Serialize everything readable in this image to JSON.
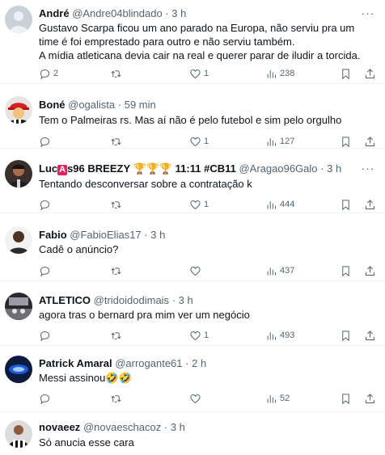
{
  "tweets": [
    {
      "name": "André",
      "handle": "@Andre04blindado",
      "time": "3 h",
      "text": "Gustavo Scarpa ficou um ano parado na Europa, não serviu pra um time é foi emprestado para outro e não serviu também.\nA mídia atleticana devia cair na real e querer parar de iludir a torcida.",
      "replies": "2",
      "retweets": "",
      "likes": "1",
      "views": "238"
    },
    {
      "name": "Boné",
      "handle": "@ogalista",
      "time": "59 min",
      "text": "Tem o Palmeiras rs. Mas aí não é pelo futebol e sim pelo orgulho",
      "replies": "",
      "retweets": "",
      "likes": "1",
      "views": "127"
    },
    {
      "name_pre": "Luc",
      "name_badge": "A",
      "name_post": "s96 BREEZY 🏆🏆🏆 11:11 #CB11",
      "handle": "@Aragao96Galo",
      "time": "3 h",
      "text": "Tentando desconversar sobre a contratação k",
      "replies": "",
      "retweets": "",
      "likes": "1",
      "views": "444"
    },
    {
      "name": "Fabio",
      "handle": "@FabioElias17",
      "time": "3 h",
      "text": "Cadê o anúncio?",
      "replies": "",
      "retweets": "",
      "likes": "",
      "views": "437"
    },
    {
      "name": "ATLETICO",
      "handle": "@tridoidodimais",
      "time": "3 h",
      "text": "agora tras o bernard pra mim ver um negócio",
      "replies": "",
      "retweets": "",
      "likes": "1",
      "views": "493"
    },
    {
      "name": "Patrick Amaral",
      "handle": "@arrogante61",
      "time": "2 h",
      "text": "Messi assinou🤣🤣",
      "replies": "",
      "retweets": "",
      "likes": "",
      "views": "52"
    },
    {
      "name": "novaeez",
      "handle": "@novaeschacoz",
      "time": "3 h",
      "text": "Só anucia esse cara",
      "replies": "",
      "retweets": "",
      "likes": "",
      "views": ""
    }
  ],
  "separator": "·",
  "more_glyph": "···"
}
